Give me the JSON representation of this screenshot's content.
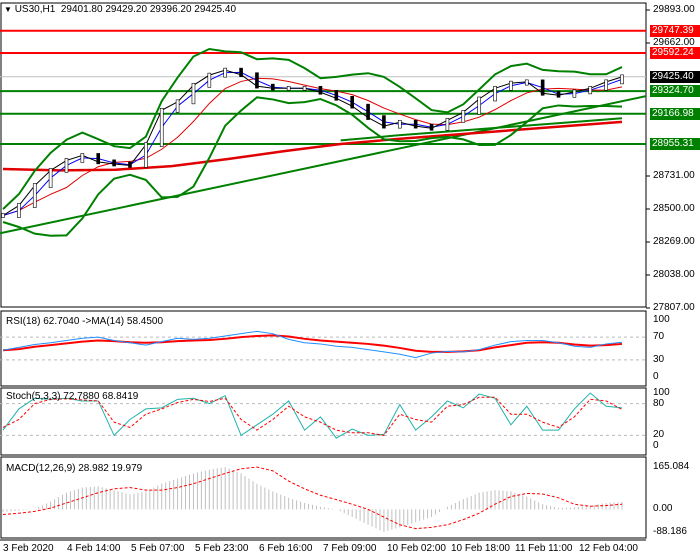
{
  "header": {
    "symbol": "US30,H1",
    "ohlc": "29401.80 29429.20 29396.20 29425.40"
  },
  "colors": {
    "resistance": "#ff0000",
    "support": "#008000",
    "current": "#000000",
    "rsi": "#1e90ff",
    "rsi_ma": "#ff0000",
    "stoch_k": "#20b2aa",
    "stoch_d": "#ff0000",
    "macd_hist": "#c0c0c0"
  },
  "chart_data": [
    {
      "type": "line",
      "title": "US30,H1",
      "ylim": [
        27807,
        29893
      ],
      "yticks": [
        "29893.00",
        "29662.00",
        "28731.00",
        "28500.00",
        "28269.00",
        "28038.00",
        "27807.00"
      ],
      "xticks": [
        "3 Feb 2020",
        "4 Feb 14:00",
        "5 Feb 07:00",
        "5 Feb 23:00",
        "6 Feb 16:00",
        "7 Feb 09:00",
        "10 Feb 02:00",
        "10 Feb 18:00",
        "11 Feb 11:00",
        "12 Feb 04:00"
      ],
      "close": [
        28454,
        28524,
        28664,
        28770,
        28840,
        28875,
        28830,
        28815,
        28805,
        28950,
        29191,
        29250,
        29366,
        29437,
        29472,
        29440,
        29360,
        29345,
        29345,
        29345,
        29317,
        29275,
        29220,
        29140,
        29080,
        29107,
        29080,
        29065,
        29121,
        29177,
        29270,
        29345,
        29381,
        29390,
        29310,
        29296,
        29320,
        29345,
        29390,
        29425
      ],
      "ma_slow": [
        28780,
        28770,
        28775,
        28800,
        28850,
        28905,
        28955,
        28990,
        29020,
        29050,
        29080,
        29110
      ],
      "levels": [
        {
          "label": "29747.39",
          "value": 29747.39,
          "kind": "resistance"
        },
        {
          "label": "29592.24",
          "value": 29592.24,
          "kind": "resistance"
        },
        {
          "label": "29425.40",
          "value": 29425.4,
          "kind": "current"
        },
        {
          "label": "29324.70",
          "value": 29324.7,
          "kind": "support"
        },
        {
          "label": "29166.98",
          "value": 29166.98,
          "kind": "support"
        },
        {
          "label": "28955.31",
          "value": 28955.31,
          "kind": "support"
        }
      ],
      "trendline": [
        28330,
        29290
      ]
    },
    {
      "type": "line",
      "title": "RSI(18) 62.7040  ->MA(14) 58.4500",
      "ylim": [
        0,
        100
      ],
      "yticks": [
        "100",
        "70",
        "30",
        "0"
      ],
      "rsi": [
        47,
        52,
        57,
        60,
        64,
        68,
        70,
        64,
        60,
        56,
        62,
        68,
        66,
        68,
        72,
        76,
        80,
        76,
        66,
        60,
        58,
        54,
        52,
        48,
        44,
        40,
        34,
        42,
        45,
        44,
        48,
        56,
        62,
        64,
        64,
        60,
        54,
        52,
        58,
        61
      ],
      "ma": [
        47,
        49,
        53,
        56,
        59,
        62,
        64,
        63,
        61,
        60,
        61,
        63,
        64,
        65,
        67,
        70,
        72,
        73,
        71,
        67,
        64,
        62,
        60,
        58,
        55,
        51,
        46,
        44,
        44,
        45,
        47,
        52,
        56,
        60,
        61,
        60,
        57,
        55,
        56,
        58
      ]
    },
    {
      "type": "line",
      "title": "Stoch(5,3,3) 72.7880 68.8419",
      "ylim": [
        0,
        100
      ],
      "yticks": [
        "100",
        "80",
        "20",
        "0"
      ],
      "k": [
        30,
        70,
        90,
        88,
        90,
        85,
        85,
        20,
        50,
        70,
        72,
        88,
        90,
        80,
        95,
        20,
        40,
        60,
        85,
        30,
        55,
        15,
        32,
        20,
        22,
        78,
        30,
        55,
        85,
        72,
        98,
        90,
        40,
        75,
        30,
        30,
        70,
        100,
        75,
        72
      ],
      "d": [
        35,
        50,
        80,
        88,
        89,
        87,
        85,
        45,
        35,
        60,
        70,
        82,
        88,
        84,
        90,
        50,
        30,
        50,
        75,
        55,
        45,
        30,
        25,
        25,
        20,
        60,
        50,
        45,
        75,
        78,
        92,
        92,
        60,
        60,
        45,
        35,
        55,
        88,
        85,
        69
      ]
    },
    {
      "type": "bar",
      "title": "MACD(12,26,9) 28.982 19.979",
      "ylim": [
        -88.186,
        165.084
      ],
      "yticks": [
        "165.084",
        "0.00",
        "-88.186"
      ],
      "hist": [
        -10,
        -5,
        2,
        30,
        65,
        85,
        90,
        75,
        58,
        70,
        100,
        120,
        140,
        155,
        165,
        140,
        100,
        70,
        45,
        25,
        10,
        0,
        -30,
        -60,
        -88,
        -70,
        -50,
        -30,
        10,
        40,
        65,
        75,
        70,
        50,
        20,
        5,
        8,
        15,
        25,
        29
      ],
      "signal": [
        -20,
        -15,
        -8,
        5,
        25,
        45,
        65,
        80,
        85,
        75,
        75,
        85,
        100,
        120,
        140,
        158,
        165,
        150,
        110,
        80,
        55,
        38,
        20,
        0,
        -30,
        -60,
        -75,
        -70,
        -60,
        -40,
        -15,
        20,
        50,
        62,
        60,
        45,
        20,
        12,
        15,
        20
      ]
    }
  ]
}
